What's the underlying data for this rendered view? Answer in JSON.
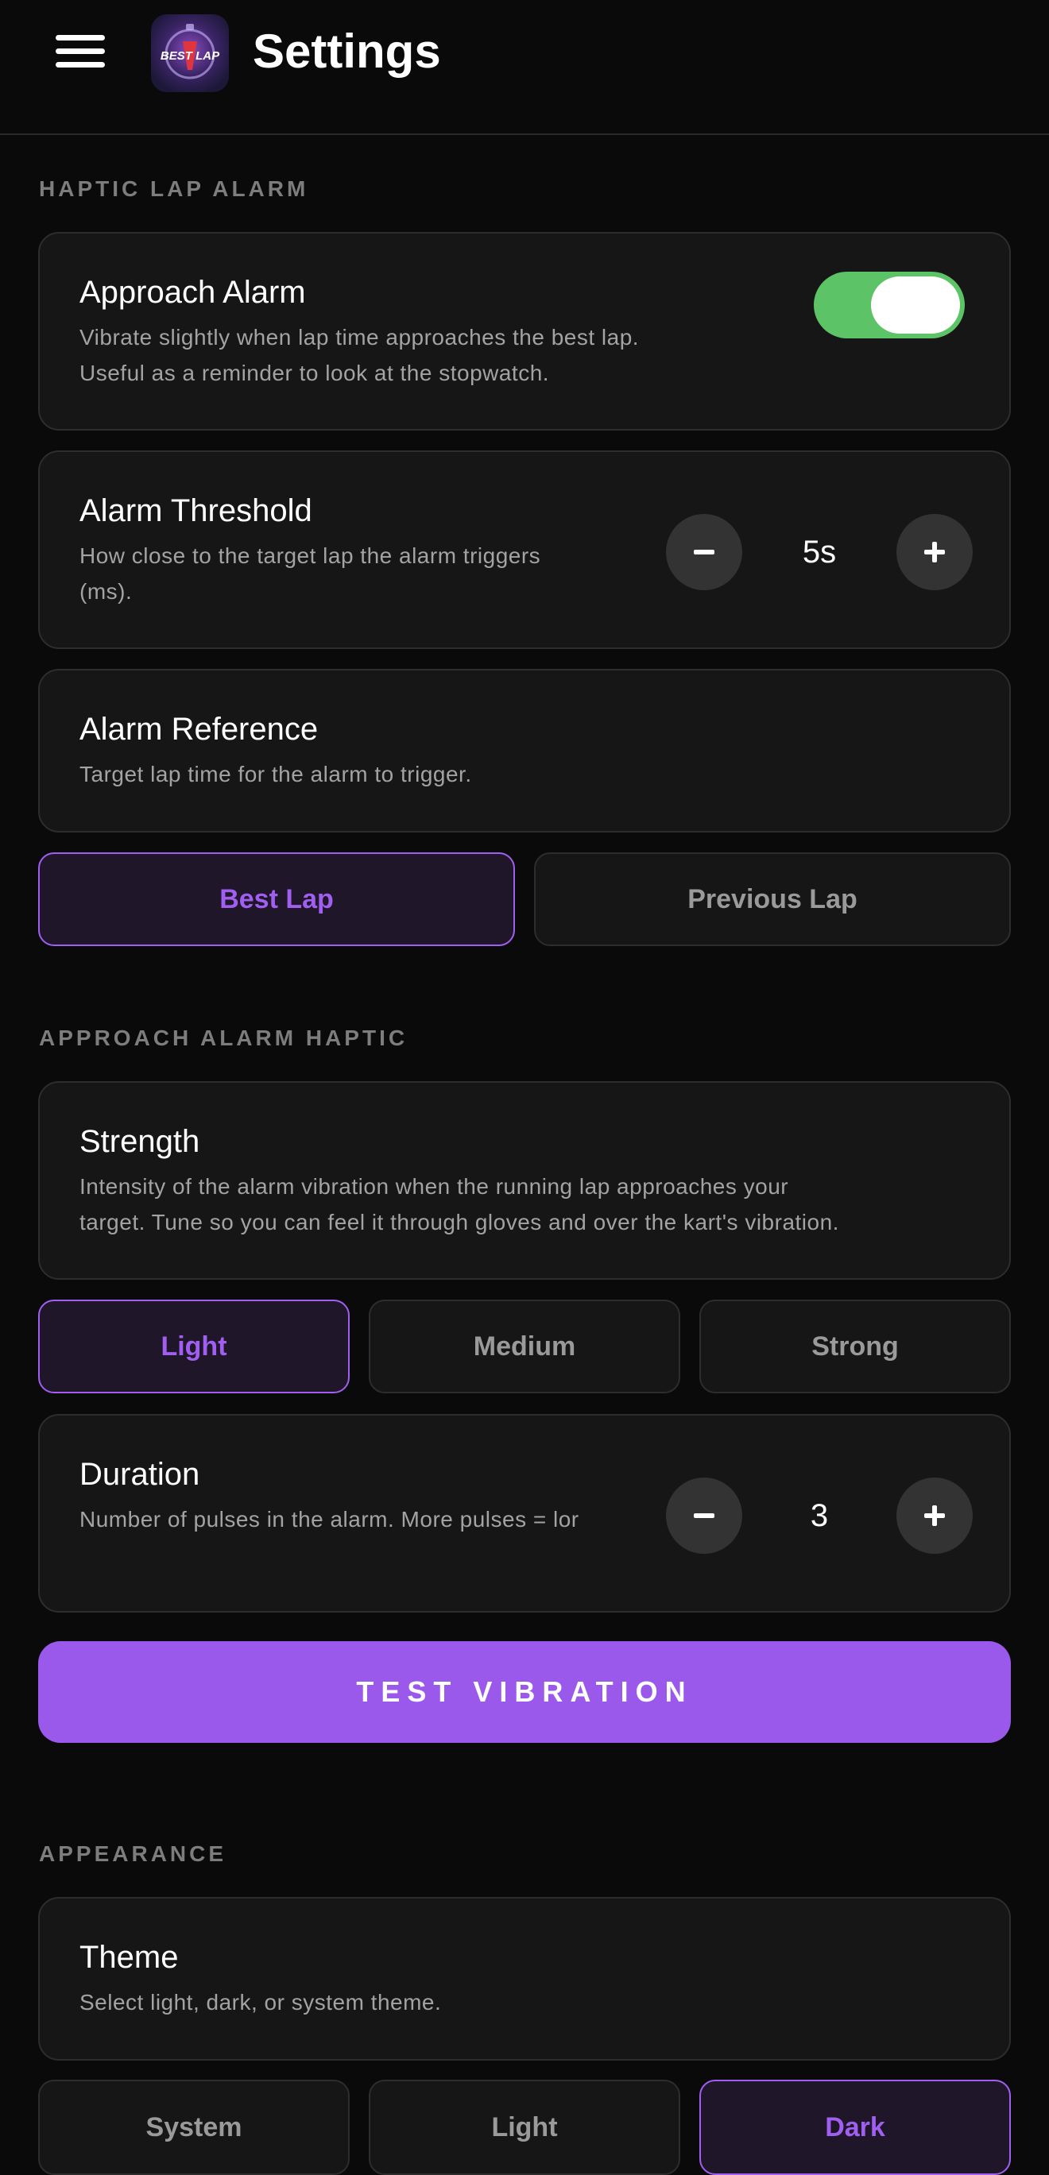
{
  "header": {
    "title": "Settings",
    "logo_text": "BEST LAP"
  },
  "sections": {
    "haptic": "HAPTIC LAP ALARM",
    "approach_haptic": "APPROACH ALARM HAPTIC",
    "appearance": "APPEARANCE"
  },
  "approach_alarm": {
    "title": "Approach Alarm",
    "desc_line1": "Vibrate slightly when lap time approaches the best lap.",
    "desc_line2": "Useful as a reminder to look at the stopwatch.",
    "enabled": true
  },
  "threshold": {
    "title": "Alarm Threshold",
    "desc_line1": "How close to the target lap the alarm triggers",
    "desc_line2": "(ms).",
    "value": "5s"
  },
  "reference": {
    "title": "Alarm Reference",
    "desc": "Target lap time for the alarm to trigger.",
    "options": [
      "Best Lap",
      "Previous Lap"
    ],
    "selected": "Best Lap"
  },
  "strength": {
    "title": "Strength",
    "desc_line1": "Intensity of the alarm vibration when the running lap approaches your",
    "desc_line2": "target. Tune so you can feel it through gloves and over the kart's vibration.",
    "options": [
      "Light",
      "Medium",
      "Strong"
    ],
    "selected": "Light"
  },
  "duration": {
    "title": "Duration",
    "desc": "Number of pulses in the alarm. More pulses = lor",
    "value": "3"
  },
  "test_button": "TEST VIBRATION",
  "theme": {
    "title": "Theme",
    "desc": "Select light, dark, or system theme.",
    "options": [
      "System",
      "Light",
      "Dark"
    ],
    "selected": "Dark"
  },
  "colors": {
    "accent": "#a05ff0",
    "button": "#9b59ec",
    "toggle_on": "#5cc466",
    "background": "#0a0a0a",
    "card": "#161616"
  }
}
